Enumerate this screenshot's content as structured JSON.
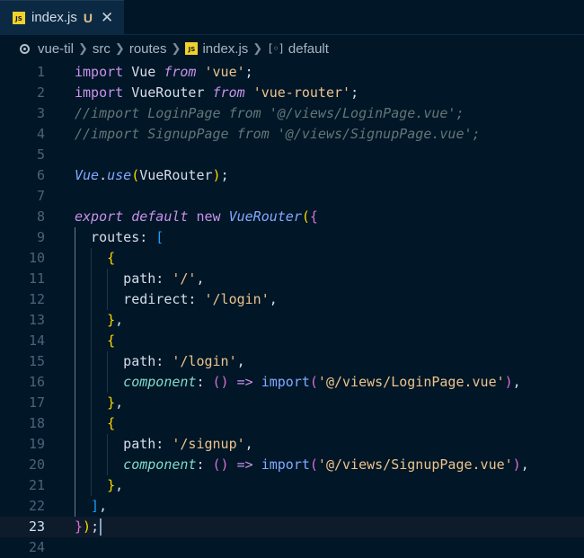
{
  "tab": {
    "badge": "JS",
    "filename": "index.js",
    "status": "U",
    "close": "✕"
  },
  "breadcrumb": {
    "items": [
      "vue-til",
      "src",
      "routes",
      "index.js",
      "default"
    ],
    "file_badge": "JS",
    "symbol_glyph": "[◦]"
  },
  "editor": {
    "current_line": 23,
    "lines": [
      {
        "n": 1,
        "tokens": [
          [
            "import",
            "kw"
          ],
          [
            " Vue ",
            "id"
          ],
          [
            "from",
            "kwi"
          ],
          [
            " ",
            "id"
          ],
          [
            "'vue'",
            "str"
          ],
          [
            ";",
            "punc"
          ]
        ]
      },
      {
        "n": 2,
        "tokens": [
          [
            "import",
            "kw"
          ],
          [
            " VueRouter ",
            "id"
          ],
          [
            "from",
            "kwi"
          ],
          [
            " ",
            "id"
          ],
          [
            "'vue-router'",
            "str"
          ],
          [
            ";",
            "punc"
          ]
        ]
      },
      {
        "n": 3,
        "tokens": [
          [
            "//import LoginPage from '@/views/LoginPage.vue';",
            "cm"
          ]
        ]
      },
      {
        "n": 4,
        "tokens": [
          [
            "//import SignupPage from '@/views/SignupPage.vue';",
            "cm"
          ]
        ]
      },
      {
        "n": 5,
        "tokens": []
      },
      {
        "n": 6,
        "tokens": [
          [
            "Vue",
            "cls"
          ],
          [
            ".",
            "punc"
          ],
          [
            "use",
            "cls"
          ],
          [
            "(",
            "br1"
          ],
          [
            "VueRouter",
            "id"
          ],
          [
            ")",
            "br1"
          ],
          [
            ";",
            "punc"
          ]
        ]
      },
      {
        "n": 7,
        "tokens": []
      },
      {
        "n": 8,
        "tokens": [
          [
            "export",
            "kwi"
          ],
          [
            " ",
            "id"
          ],
          [
            "default",
            "kwi"
          ],
          [
            " ",
            "id"
          ],
          [
            "new",
            "kw"
          ],
          [
            " ",
            "id"
          ],
          [
            "VueRouter",
            "cls"
          ],
          [
            "(",
            "br1"
          ],
          [
            "{",
            "br2"
          ]
        ]
      },
      {
        "n": 9,
        "indent": 1,
        "tokens": [
          [
            "routes",
            "prop"
          ],
          [
            ": ",
            "punc"
          ],
          [
            "[",
            "br3"
          ]
        ]
      },
      {
        "n": 10,
        "indent": 2,
        "tokens": [
          [
            "{",
            "br4"
          ]
        ]
      },
      {
        "n": 11,
        "indent": 3,
        "tokens": [
          [
            "path",
            "prop"
          ],
          [
            ": ",
            "punc"
          ],
          [
            "'/'",
            "str"
          ],
          [
            ",",
            "punc"
          ]
        ]
      },
      {
        "n": 12,
        "indent": 3,
        "tokens": [
          [
            "redirect",
            "prop"
          ],
          [
            ": ",
            "punc"
          ],
          [
            "'/login'",
            "str"
          ],
          [
            ",",
            "punc"
          ]
        ]
      },
      {
        "n": 13,
        "indent": 2,
        "tokens": [
          [
            "}",
            "br4"
          ],
          [
            ",",
            "punc"
          ]
        ]
      },
      {
        "n": 14,
        "indent": 2,
        "tokens": [
          [
            "{",
            "br4"
          ]
        ]
      },
      {
        "n": 15,
        "indent": 3,
        "tokens": [
          [
            "path",
            "prop"
          ],
          [
            ": ",
            "punc"
          ],
          [
            "'/login'",
            "str"
          ],
          [
            ",",
            "punc"
          ]
        ]
      },
      {
        "n": 16,
        "indent": 3,
        "tokens": [
          [
            "component",
            "propi"
          ],
          [
            ": ",
            "punc"
          ],
          [
            "()",
            "br2"
          ],
          [
            " ",
            "id"
          ],
          [
            "=>",
            "op"
          ],
          [
            " ",
            "id"
          ],
          [
            "import",
            "fn"
          ],
          [
            "(",
            "br2"
          ],
          [
            "'@/views/LoginPage.vue'",
            "str"
          ],
          [
            ")",
            "br2"
          ],
          [
            ",",
            "punc"
          ]
        ]
      },
      {
        "n": 17,
        "indent": 2,
        "tokens": [
          [
            "}",
            "br4"
          ],
          [
            ",",
            "punc"
          ]
        ]
      },
      {
        "n": 18,
        "indent": 2,
        "tokens": [
          [
            "{",
            "br4"
          ]
        ]
      },
      {
        "n": 19,
        "indent": 3,
        "tokens": [
          [
            "path",
            "prop"
          ],
          [
            ": ",
            "punc"
          ],
          [
            "'/signup'",
            "str"
          ],
          [
            ",",
            "punc"
          ]
        ]
      },
      {
        "n": 20,
        "indent": 3,
        "tokens": [
          [
            "component",
            "propi"
          ],
          [
            ": ",
            "punc"
          ],
          [
            "()",
            "br2"
          ],
          [
            " ",
            "id"
          ],
          [
            "=>",
            "op"
          ],
          [
            " ",
            "id"
          ],
          [
            "import",
            "fn"
          ],
          [
            "(",
            "br2"
          ],
          [
            "'@/views/SignupPage.vue'",
            "str"
          ],
          [
            ")",
            "br2"
          ],
          [
            ",",
            "punc"
          ]
        ]
      },
      {
        "n": 21,
        "indent": 2,
        "tokens": [
          [
            "}",
            "br4"
          ],
          [
            ",",
            "punc"
          ]
        ]
      },
      {
        "n": 22,
        "indent": 1,
        "tokens": [
          [
            "]",
            "br3"
          ],
          [
            ",",
            "punc"
          ]
        ]
      },
      {
        "n": 23,
        "tokens": [
          [
            "}",
            "br2"
          ],
          [
            ")",
            "br1"
          ],
          [
            ";",
            "punc"
          ]
        ],
        "cursor": true
      },
      {
        "n": 24,
        "tokens": []
      }
    ]
  }
}
